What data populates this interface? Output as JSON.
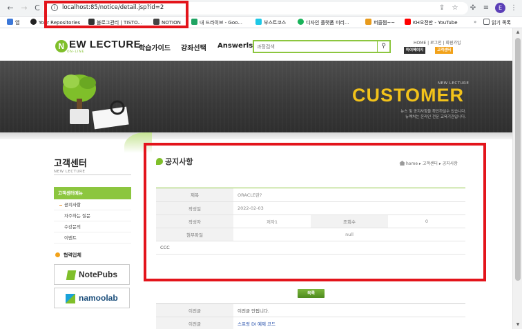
{
  "browser": {
    "url": "localhost:85/notice/detail.jsp?id=2",
    "profile_initial": "E",
    "bookmarks": [
      {
        "label": "앱",
        "color": "#3c78d8"
      },
      {
        "label": "Your Repositories",
        "color": "#222222"
      },
      {
        "label": "블로그관리 | TISTO...",
        "color": "#333333"
      },
      {
        "label": "NOTION",
        "color": "#444444"
      },
      {
        "label": "내 드라이브 - Goo...",
        "color": "#1fa463"
      },
      {
        "label": "부스트코스",
        "color": "#1ec8e6"
      },
      {
        "label": "디자인 플랫폼 미리...",
        "color": "#19b35a"
      },
      {
        "label": "퍼즐젬~~",
        "color": "#e89b1d"
      },
      {
        "label": "KH오전반 - YouTube",
        "color": "#ff0000"
      },
      {
        "label": "읽기 목록",
        "color": "#5f6368"
      }
    ]
  },
  "site": {
    "logo_text": "EW LECTURE",
    "logo_letter": "N",
    "logo_sub": "ON-LINE",
    "gnb": [
      "학습가이드",
      "강좌선택",
      "Answerls"
    ],
    "search_placeholder": "과정검색",
    "util_links": "HOME | 로그인 | 회원가입",
    "util_buttons": [
      "마이페이지",
      "고객센터"
    ]
  },
  "banner": {
    "sub": "NEW LECTURE",
    "title": "CUSTOMER",
    "desc_line1": "뉴스 및 공지사항을 확인하실수 있습니다.",
    "desc_line2": "뉴렉처는 온라인 전문 교육기관입니다."
  },
  "sidebar": {
    "title": "고객센터",
    "subtitle": "NEW LECTURE",
    "menu_head": "고객센터메뉴",
    "items": [
      "공지사항",
      "자주하는 질문",
      "수강문의",
      "이벤트"
    ],
    "partner_title": "협력업체",
    "partners": [
      "NotePubs",
      "namoolab"
    ]
  },
  "main": {
    "title": "공지사항",
    "breadcrumb": "home ▸ 고객센터 ▸ 공지사항",
    "fields": {
      "title_label": "제목",
      "title_value": "ORACLE란?",
      "date_label": "작성일",
      "date_value": "2022-02-03",
      "writer_label": "작성자",
      "writer_value": "저자1",
      "hit_label": "조회수",
      "hit_value": "0",
      "file_label": "첨부파일",
      "file_value": "null"
    },
    "content": "CCC",
    "list_button": "목록",
    "prev_label": "이전글",
    "prev_value": "이전글 안됩니다.",
    "next_label": "이전글",
    "next_value": "스프링 DI 예제 코드"
  },
  "colors": {
    "accent": "#8cc63f",
    "highlight": "#e3141b",
    "banner_title": "#f2c21a"
  }
}
